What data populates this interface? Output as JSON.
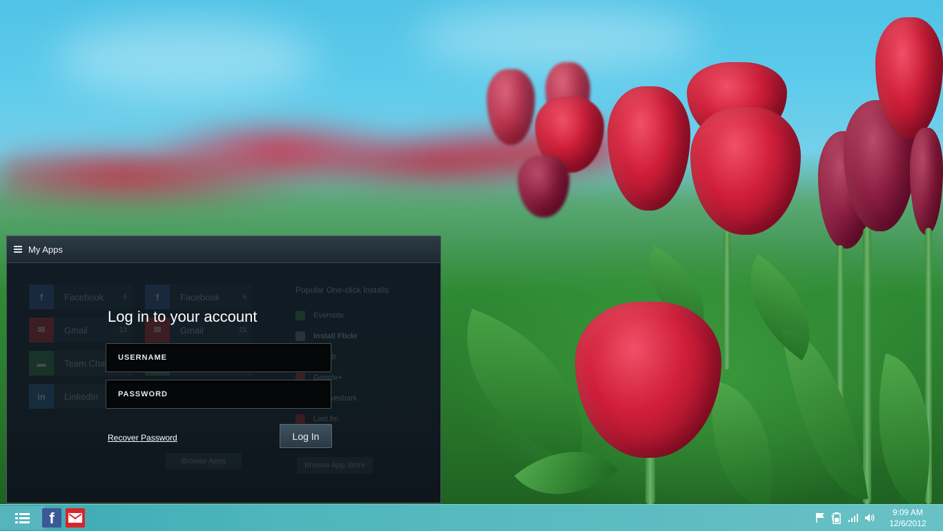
{
  "window": {
    "title": "My Apps",
    "background_tiles": [
      {
        "name": "Facebook",
        "count": "6"
      },
      {
        "name": "Gmail",
        "count": "23"
      },
      {
        "name": "Team Chat",
        "badge": "NEW"
      },
      {
        "name": "LinkedIn",
        "count": "2"
      }
    ],
    "popular": {
      "title": "Popular One-click Installs",
      "items": [
        "Evernote",
        "Install Flickr",
        "Github",
        "Google+",
        "Grooveshark",
        "Last.fm"
      ]
    },
    "browse_apps_label": "Browse Apps",
    "browse_store_label": "Browse App Store"
  },
  "login": {
    "heading": "Log in to your account",
    "username_placeholder": "USERNAME",
    "password_placeholder": "PASSWORD",
    "recover_label": "Recover Password",
    "submit_label": "Log In"
  },
  "taskbar": {
    "pinned": [
      {
        "icon": "apps-list-icon"
      },
      {
        "icon": "facebook-icon",
        "letter": "f"
      },
      {
        "icon": "gmail-icon"
      }
    ],
    "tray": [
      "flag-icon",
      "battery-icon",
      "signal-icon",
      "volume-icon"
    ],
    "time": "9:09 AM",
    "date": "12/6/2012"
  },
  "colors": {
    "facebook": "#3b5998",
    "gmail": "#d8262a",
    "taskbar": "#3fb0b7"
  }
}
